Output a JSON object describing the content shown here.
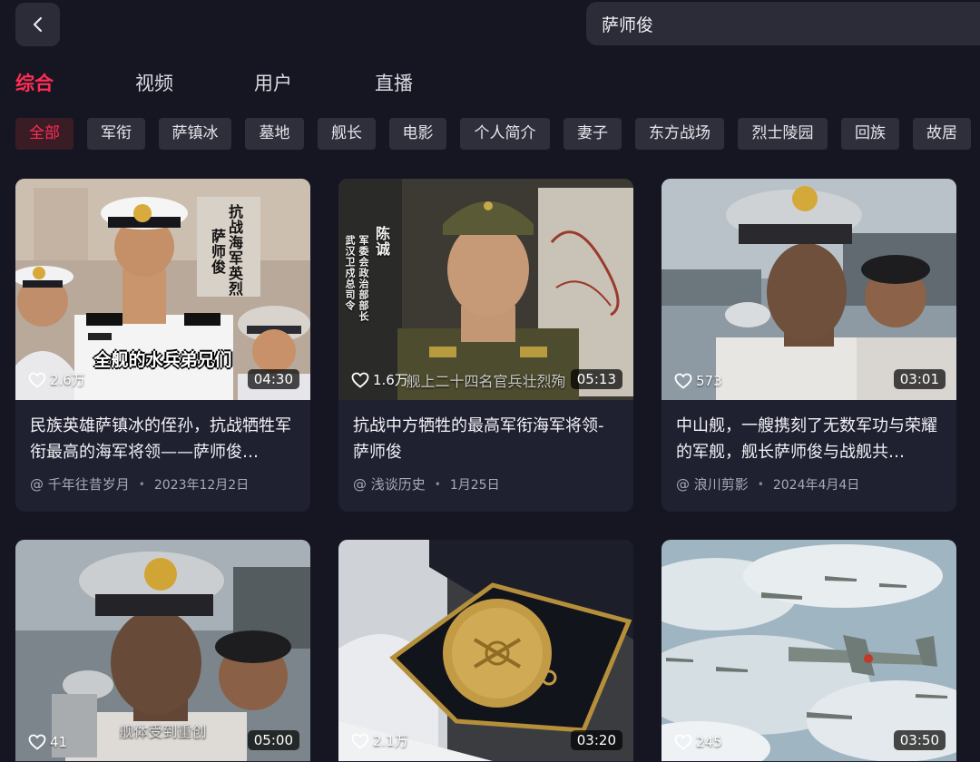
{
  "header": {
    "back_icon": "chevron-left-icon",
    "search_value": "萨师俊"
  },
  "tabs": [
    {
      "label": "综合",
      "active": true
    },
    {
      "label": "视频",
      "active": false
    },
    {
      "label": "用户",
      "active": false
    },
    {
      "label": "直播",
      "active": false
    }
  ],
  "chips": [
    {
      "label": "全部",
      "active": true
    },
    {
      "label": "军衔"
    },
    {
      "label": "萨镇冰"
    },
    {
      "label": "墓地"
    },
    {
      "label": "舰长"
    },
    {
      "label": "电影"
    },
    {
      "label": "个人简介"
    },
    {
      "label": "妻子"
    },
    {
      "label": "东方战场"
    },
    {
      "label": "烈士陵园"
    },
    {
      "label": "回族"
    },
    {
      "label": "故居"
    }
  ],
  "colors": {
    "accent": "#ff2d55",
    "background": "#161622",
    "card": "#1f2030",
    "chip": "#2e2f3a"
  },
  "cards": [
    {
      "likes": "2.6万",
      "duration": "04:30",
      "title": "民族英雄萨镇冰的侄孙，抗战牺牲军衔最高的海军将领——萨师俊…",
      "author": "@ 千年往昔岁月",
      "date": "2023年12月2日",
      "overlay_caption": "全舰的水兵弟兄们",
      "overlay_vertical_1": "抗战海军英烈",
      "overlay_vertical_2": "萨师俊"
    },
    {
      "likes": "1.6万",
      "duration": "05:13",
      "title": "抗战中方牺牲的最高军衔海军将领-萨师俊",
      "author": "@ 浅谈历史",
      "date": "1月25日",
      "overlay_sub": "舰上二十四名官兵壮烈殉",
      "overlay_vertical_1": "陈诚",
      "overlay_vertical_2": "军委会政治部部长",
      "overlay_vertical_3": "武汉卫戍总司令"
    },
    {
      "likes": "573",
      "duration": "03:01",
      "title": "中山舰，一艘携刻了无数军功与荣耀的军舰，舰长萨师俊与战舰共…",
      "author": "@ 浪川剪影",
      "date": "2024年4月4日"
    },
    {
      "likes": "41",
      "duration": "05:00",
      "overlay_sub": "舰体受到重创"
    },
    {
      "likes": "2.1万",
      "duration": "03:20"
    },
    {
      "likes": "245",
      "duration": "03:50"
    }
  ]
}
